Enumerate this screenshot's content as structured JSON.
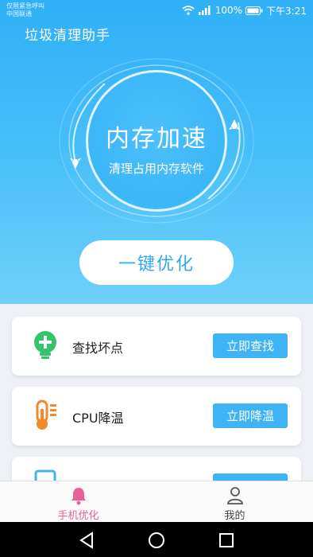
{
  "status_bar": {
    "carrier_line1": "仅限紧急呼叫",
    "carrier_line2": "中国联通",
    "battery": "100%",
    "time": "下午3:21"
  },
  "app_title": "垃圾清理助手",
  "hero": {
    "title": "内存加速",
    "subtitle": "清理占用内存软件",
    "optimize_button": "一键优化"
  },
  "cards": [
    {
      "label": "查找坏点",
      "button": "立即查找",
      "icon": "bulb-plus-icon",
      "color": "#36c46a"
    },
    {
      "label": "CPU降温",
      "button": "立即降温",
      "icon": "thermometer-icon",
      "color": "#f08a2c"
    },
    {
      "label": "",
      "button": "",
      "icon": "phone-icon",
      "color": "#3eb4f6"
    }
  ],
  "tabs": [
    {
      "label": "手机优化",
      "icon": "bell-icon",
      "active": true,
      "color": "#e8619a"
    },
    {
      "label": "我的",
      "icon": "user-icon",
      "active": false,
      "color": "#555555"
    }
  ],
  "colors": {
    "accent": "#3eb4f6",
    "active_tab": "#e8619a"
  }
}
